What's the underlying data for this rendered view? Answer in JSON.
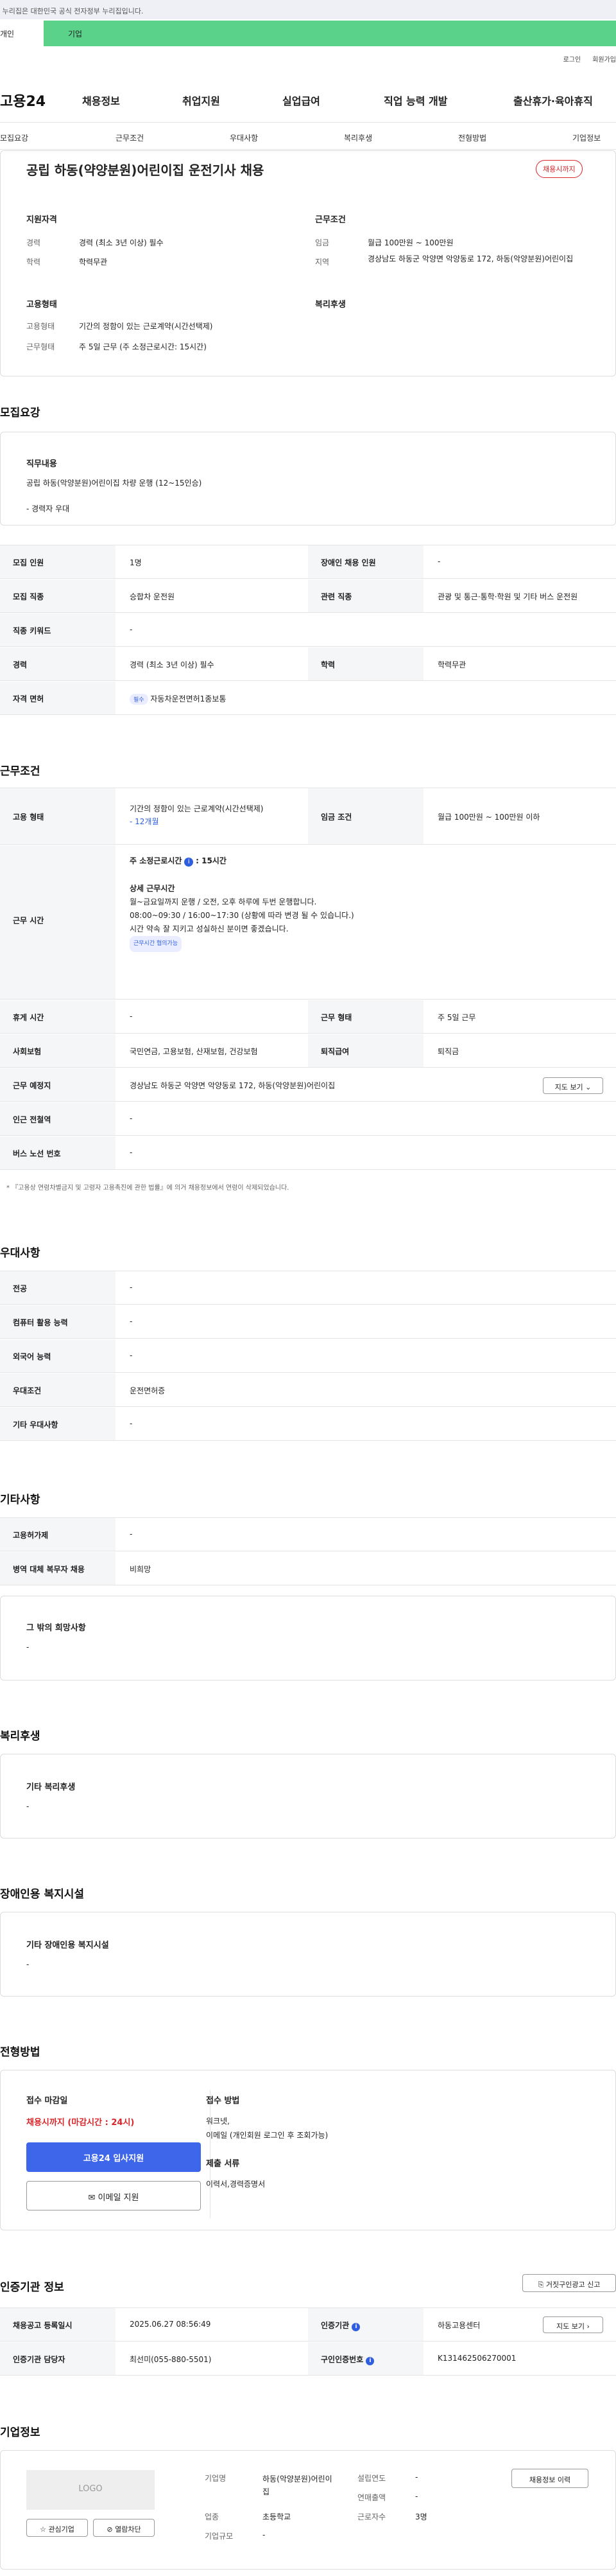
{
  "gov_banner": "이 누리집은 대한민국 공식 전자정부 누리집입니다.",
  "user_type": {
    "individual": "개인",
    "enterprise": "기업"
  },
  "top_links": {
    "login": "로그인",
    "join": "회원가입"
  },
  "gnb": {
    "logo": "고용24",
    "menu": [
      "채용정보",
      "취업지원",
      "실업급여",
      "직업 능력 개발",
      "출산휴가·육아휴직"
    ]
  },
  "tabs": [
    "모집요강",
    "근무조건",
    "우대사항",
    "복리후생",
    "전형방법",
    "기업정보"
  ],
  "job": {
    "title": "공립 하동(약양분원)어린이집 운전기사 채용",
    "badge": "채용시까지",
    "qual_label": "지원자격",
    "career_label": "경력",
    "career": "경력 (최소 3년 이상) 필수",
    "edu_label": "학력",
    "edu": "학력무관",
    "cond_label": "근무조건",
    "wage_label": "임금",
    "wage": "월급 100만원 ~ 100만원",
    "region_label": "지역",
    "region": "경상남도 하동군 악양면 악양동로 172, 하동(악양분원)어린이집",
    "emp_label": "고용형태",
    "emp_type_label": "고용형태",
    "emp_type": "기간의 정함이 있는 근로계약(시간선택제)",
    "work_type_label": "근무형태",
    "work_type": "주 5일 근무 (주 소정근로시간: 15시간)",
    "welfare_label": "복리후생"
  },
  "recruit": {
    "heading": "모집요강",
    "duty_label": "직무내용",
    "duty": "공립 하동(악양분원)어린이집 차량 운행 (12~15인승)",
    "duty_note": "- 경력자 우대",
    "rows": [
      {
        "h1": "모집 인원",
        "v1": "1명",
        "h2": "장애인 채용 인원",
        "v2": "-"
      },
      {
        "h1": "모집 직종",
        "v1": "승합차 운전원",
        "h2": "관련 직종",
        "v2": "관광 및 통근·통학·학원 및 기타 버스 운전원"
      },
      {
        "h1": "직종 키워드",
        "v1": "-"
      },
      {
        "h1": "경력",
        "v1": "경력 (최소 3년 이상) 필수",
        "h2": "학력",
        "v2": "학력무관"
      },
      {
        "h1": "자격 면허",
        "tag": "필수",
        "v1": "자동차운전면허1종보통"
      }
    ]
  },
  "conditions": {
    "heading": "근무조건",
    "emp_label": "고용 형태",
    "emp": "기간의 정함이 있는 근로계약(시간선택제)",
    "emp_period": "- 12개월",
    "wage_label": "임금 조건",
    "wage": "월급 100만원 ~ 100만원 이하",
    "hours_label": "근무 시간",
    "hours_title": "주 소정근로시간",
    "hours_value": ": 15시간",
    "hours_detail_title": "상세 근무시간",
    "hours_line1": "월~금요일까지 운행 / 오전, 오후 하루에 두번 운행합니다.",
    "hours_line2": "08:00~09:30  / 16:00~17:30 (상황에 따라 변경 될 수 있습니다.)",
    "hours_line3": "시간 약속 잘 지키고 성실하신 분이면 좋겠습니다.",
    "hours_tag": "근무시간 협의가능",
    "rows": [
      {
        "h1": "휴게 시간",
        "v1": "-",
        "h2": "근무 형태",
        "v2": "주 5일 근무"
      },
      {
        "h1": "사회보험",
        "v1": "국민연금, 고용보험, 산재보험, 건강보험",
        "h2": "퇴직급여",
        "v2": "퇴직금"
      },
      {
        "h1": "근무 예정지",
        "v1": "경상남도 하동군 악양면 악양동로 172, 하동(악양분원)어린이집",
        "btn": "지도 보기"
      },
      {
        "h1": "인근 전철역",
        "v1": "-"
      },
      {
        "h1": "버스 노선 번호",
        "v1": "-"
      }
    ],
    "note": "* 『고용상 연령차별금지 및 고령자 고용촉진에 관한 법률』에 의거 채용정보에서 연령이 삭제되었습니다."
  },
  "preference": {
    "heading": "우대사항",
    "rows": [
      {
        "h": "전공",
        "v": "-"
      },
      {
        "h": "컴퓨터 활용 능력",
        "v": "-"
      },
      {
        "h": "외국어 능력",
        "v": "-"
      },
      {
        "h": "우대조건",
        "v": "운전면허증"
      },
      {
        "h": "기타 우대사항",
        "v": "-"
      }
    ]
  },
  "etc": {
    "heading": "기타사항",
    "rows": [
      {
        "h": "고용허가제",
        "v": "-"
      },
      {
        "h": "병역 대체 복무자 채용",
        "v": "비희망"
      }
    ],
    "box_title": "그 밖의 희망사항",
    "box_value": "-"
  },
  "welfare": {
    "heading": "복리후생",
    "box_title": "기타 복리후생",
    "box_value": "-"
  },
  "disability": {
    "heading": "장애인용 복지시설",
    "box_title": "기타 장애인용 복지시설",
    "box_value": "-"
  },
  "selection": {
    "heading": "전형방법",
    "deadline_label": "접수 마감일",
    "deadline": "채용시까지 (마감시간 : 24시)",
    "apply_btn": "고용24 입사지원",
    "email_btn": "이메일 지원",
    "method_label": "접수 방법",
    "method": "워크넷,",
    "method2": "이메일 (개인회원 로그인 후 조회가능)",
    "docs_label": "제출 서류",
    "docs": "이력서,경력증명서"
  },
  "cert": {
    "heading": "인증기관 정보",
    "report_btn": "거짓구인광고 신고",
    "r1h1": "채용공고 등록일시",
    "r1v1": "2025.06.27 08:56:49",
    "r1h2": "인증기관",
    "r1v2": "하동고용센터",
    "r1btn": "지도 보기",
    "r2h1": "인증기관 담당자",
    "r2v1": "최선미(055-880-5501)",
    "r2h2": "구인인증번호",
    "r2v2": "K131462506270001"
  },
  "company": {
    "heading": "기업정보",
    "logo": "LOGO",
    "fav_btn": "관심기업",
    "block_btn": "열람차단",
    "name_label": "기업명",
    "name": "하동(악양분원)어린이집",
    "industry_label": "업종",
    "industry": "초등학교",
    "size_label": "기업규모",
    "size": "-",
    "founded_label": "설립연도",
    "founded": "-",
    "sales_label": "연매출액",
    "sales": "-",
    "staff_label": "근로자수",
    "staff": "3명",
    "history_btn": "채용정보 이력"
  },
  "colors": {
    "accent_green": "#5bd28a",
    "primary_blue": "#2f5fe0",
    "deadline_red": "#d9262a"
  }
}
